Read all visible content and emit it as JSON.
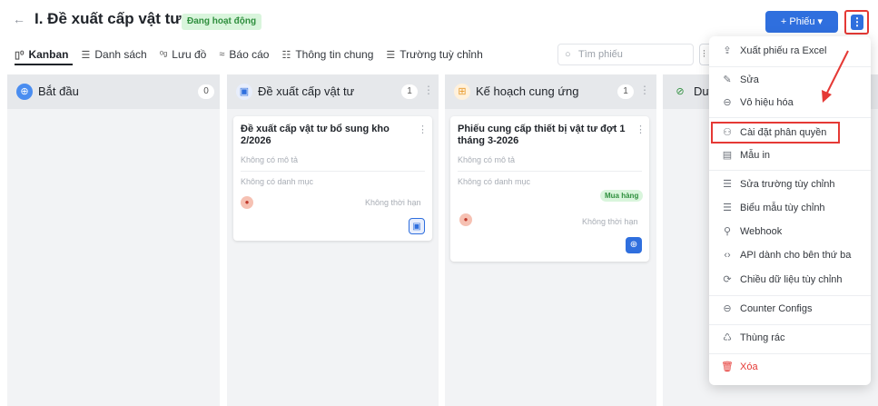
{
  "header": {
    "back_icon": "arrow-left-icon",
    "title": "I. Đề xuất cấp vật tư",
    "status": "Đang hoạt động",
    "add_button": "+ Phiếu ▾",
    "more_icon": "⋮"
  },
  "tabs": [
    {
      "icon": "▯⁰",
      "label": "Kanban"
    },
    {
      "icon": "☰",
      "label": "Danh sách"
    },
    {
      "icon": "⁰ᵍ",
      "label": "Lưu đồ"
    },
    {
      "icon": "≈",
      "label": "Báo cáo"
    },
    {
      "icon": "☷",
      "label": "Thông tin chung"
    },
    {
      "icon": "☰",
      "label": "Trường tuỳ chỉnh"
    }
  ],
  "search": {
    "placeholder": "Tìm phiếu"
  },
  "columns": [
    {
      "title": "Bắt đầu",
      "count": "0",
      "icon": "⊕",
      "icon_bg": "#4a8df0",
      "icon_color": "#ffffff"
    },
    {
      "title": "Đề xuất cấp vật tư",
      "count": "1",
      "icon": "▣",
      "icon_bg": "#e8eefc",
      "icon_color": "#2f6fde"
    },
    {
      "title": "Kế hoạch cung ứng",
      "count": "1",
      "icon": "⊞",
      "icon_bg": "#fff1dc",
      "icon_color": "#e89a2c"
    },
    {
      "title": "Duy",
      "count": "",
      "icon": "⊘",
      "icon_bg": "#e6e8eb",
      "icon_color": "#2f8f3e"
    }
  ],
  "cards": [
    {
      "title_line1": "Đề xuất cấp vật tư bổ sung kho",
      "title_line2": "2/2026",
      "desc": "Không có mô tả",
      "category": "Không có danh mục",
      "deadline": "Không thời hạn",
      "tag": ""
    },
    {
      "title_line1": "Phiếu cung cấp thiết bị vật tư đợt 1",
      "title_line2": "tháng 3-2026",
      "desc": "Không có mô tả",
      "category": "Không có danh mục",
      "deadline": "Không thời hạn",
      "tag": "Mua hàng"
    }
  ],
  "menu": {
    "items": [
      {
        "icon": "⇪",
        "label": "Xuất phiếu ra Excel"
      },
      {
        "icon": "✎",
        "label": "Sửa"
      },
      {
        "icon": "⊖",
        "label": "Vô hiệu hóa"
      },
      {
        "icon": "⚇",
        "label": "Cài đặt phân quyền"
      },
      {
        "icon": "▤",
        "label": "Mẫu in"
      },
      {
        "icon": "☰",
        "label": "Sửa trường tùy chỉnh"
      },
      {
        "icon": "☰",
        "label": "Biểu mẫu tùy chỉnh"
      },
      {
        "icon": "⚲",
        "label": "Webhook"
      },
      {
        "icon": "‹›",
        "label": "API dành cho bên thứ ba"
      },
      {
        "icon": "⟳",
        "label": "Chiều dữ liệu tùy chỉnh"
      },
      {
        "icon": "⊖",
        "label": "Counter Configs"
      },
      {
        "icon": "♺",
        "label": "Thùng rác"
      },
      {
        "icon": "🗑",
        "label": "Xóa"
      }
    ]
  },
  "colors": {
    "accent": "#2f6fde",
    "highlight": "#e53935",
    "success": "#2f8f3e"
  }
}
